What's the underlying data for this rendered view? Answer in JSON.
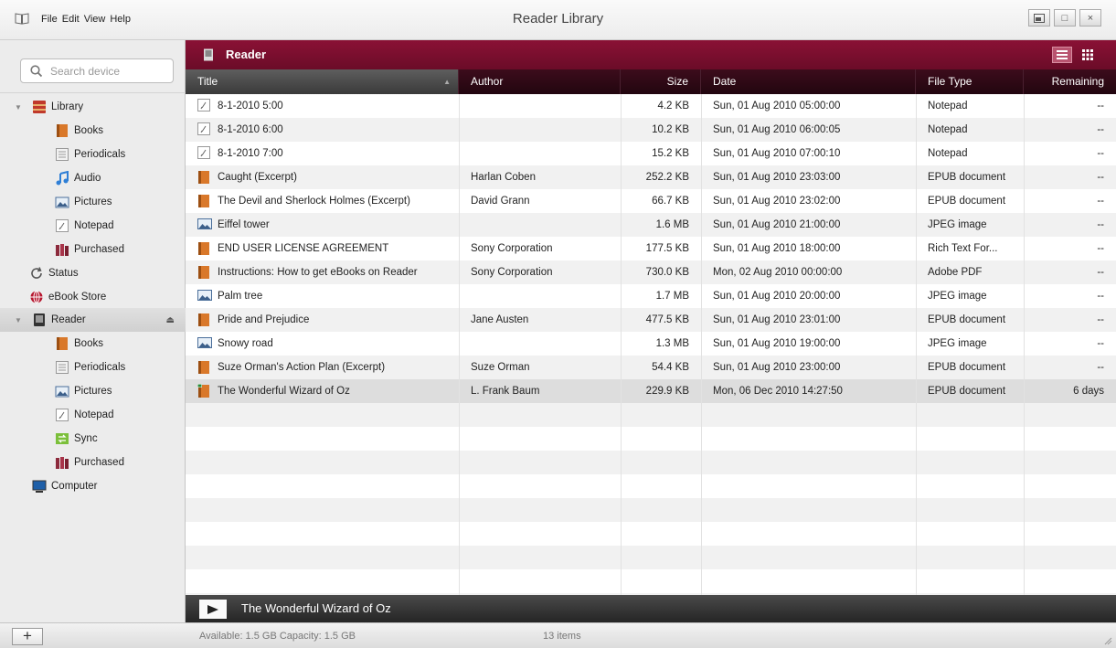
{
  "window": {
    "title": "Reader Library",
    "menu": [
      "File",
      "Edit",
      "View",
      "Help"
    ],
    "controls": {
      "minimize": "▣",
      "maximize": "□",
      "close": "×"
    }
  },
  "sidebar": {
    "search_placeholder": "Search device",
    "library": {
      "label": "Library",
      "items": [
        {
          "label": "Books",
          "icon": "book-icon"
        },
        {
          "label": "Periodicals",
          "icon": "periodical-icon"
        },
        {
          "label": "Audio",
          "icon": "music-note-icon"
        },
        {
          "label": "Pictures",
          "icon": "picture-icon"
        },
        {
          "label": "Notepad",
          "icon": "notepad-icon"
        },
        {
          "label": "Purchased",
          "icon": "purchased-books-icon"
        }
      ]
    },
    "status": {
      "label": "Status",
      "icon": "refresh-icon"
    },
    "ebook_store": {
      "label": "eBook Store",
      "icon": "globe-icon"
    },
    "reader": {
      "label": "Reader",
      "items": [
        {
          "label": "Books",
          "icon": "book-icon"
        },
        {
          "label": "Periodicals",
          "icon": "periodical-icon"
        },
        {
          "label": "Pictures",
          "icon": "picture-icon"
        },
        {
          "label": "Notepad",
          "icon": "notepad-icon"
        },
        {
          "label": "Sync",
          "icon": "sync-icon"
        },
        {
          "label": "Purchased",
          "icon": "purchased-books-icon"
        }
      ]
    },
    "computer": {
      "label": "Computer",
      "icon": "computer-icon"
    }
  },
  "panel": {
    "title": "Reader",
    "columns": [
      "Title",
      "Author",
      "Size",
      "Date",
      "File Type",
      "Remaining"
    ],
    "rows": [
      {
        "icon": "notepad",
        "title": "8-1-2010 5:00",
        "author": "",
        "size": "4.2 KB",
        "date": "Sun, 01 Aug 2010 05:00:00",
        "type": "Notepad",
        "remaining": "--"
      },
      {
        "icon": "notepad",
        "title": "8-1-2010 6:00",
        "author": "",
        "size": "10.2 KB",
        "date": "Sun, 01 Aug 2010 06:00:05",
        "type": "Notepad",
        "remaining": "--"
      },
      {
        "icon": "notepad",
        "title": "8-1-2010 7:00",
        "author": "",
        "size": "15.2 KB",
        "date": "Sun, 01 Aug 2010 07:00:10",
        "type": "Notepad",
        "remaining": "--"
      },
      {
        "icon": "book",
        "title": "Caught (Excerpt)",
        "author": "Harlan Coben",
        "size": "252.2 KB",
        "date": "Sun, 01 Aug 2010 23:03:00",
        "type": "EPUB document",
        "remaining": "--"
      },
      {
        "icon": "book",
        "title": "The Devil and Sherlock Holmes (Excerpt)",
        "author": "David Grann",
        "size": "66.7 KB",
        "date": "Sun, 01 Aug 2010 23:02:00",
        "type": "EPUB document",
        "remaining": "--"
      },
      {
        "icon": "picture",
        "title": "Eiffel tower",
        "author": "",
        "size": "1.6 MB",
        "date": "Sun, 01 Aug 2010 21:00:00",
        "type": "JPEG image",
        "remaining": "--"
      },
      {
        "icon": "book",
        "title": "END USER LICENSE AGREEMENT",
        "author": "Sony Corporation",
        "size": "177.5 KB",
        "date": "Sun, 01 Aug 2010 18:00:00",
        "type": "Rich Text For...",
        "remaining": "--"
      },
      {
        "icon": "book",
        "title": "Instructions: How to get eBooks on Reader",
        "author": "Sony Corporation",
        "size": "730.0 KB",
        "date": "Mon, 02 Aug 2010 00:00:00",
        "type": "Adobe PDF",
        "remaining": "--"
      },
      {
        "icon": "picture",
        "title": "Palm tree",
        "author": "",
        "size": "1.7 MB",
        "date": "Sun, 01 Aug 2010 20:00:00",
        "type": "JPEG image",
        "remaining": "--"
      },
      {
        "icon": "book",
        "title": "Pride and Prejudice",
        "author": "Jane Austen",
        "size": "477.5 KB",
        "date": "Sun, 01 Aug 2010 23:01:00",
        "type": "EPUB document",
        "remaining": "--"
      },
      {
        "icon": "picture",
        "title": "Snowy road",
        "author": "",
        "size": "1.3 MB",
        "date": "Sun, 01 Aug 2010 19:00:00",
        "type": "JPEG image",
        "remaining": "--"
      },
      {
        "icon": "book",
        "title": "Suze Orman's Action Plan (Excerpt)",
        "author": "Suze Orman",
        "size": "54.4 KB",
        "date": "Sun, 01 Aug 2010 23:00:00",
        "type": "EPUB document",
        "remaining": "--"
      },
      {
        "icon": "book-new",
        "title": "The Wonderful Wizard of Oz",
        "author": "L. Frank Baum",
        "size": "229.9 KB",
        "date": "Mon, 06 Dec 2010 14:27:50",
        "type": "EPUB document",
        "remaining": "6 days",
        "selected": true
      }
    ],
    "now_playing": "The Wonderful Wizard of Oz"
  },
  "statusbar": {
    "add_label": "+",
    "storage": "Available: 1.5 GB  Capacity: 1.5 GB",
    "count": "13 items"
  },
  "colors": {
    "accent": "#7a0f30",
    "header_dark": "#2a0812",
    "book_orange": "#d9782a"
  }
}
